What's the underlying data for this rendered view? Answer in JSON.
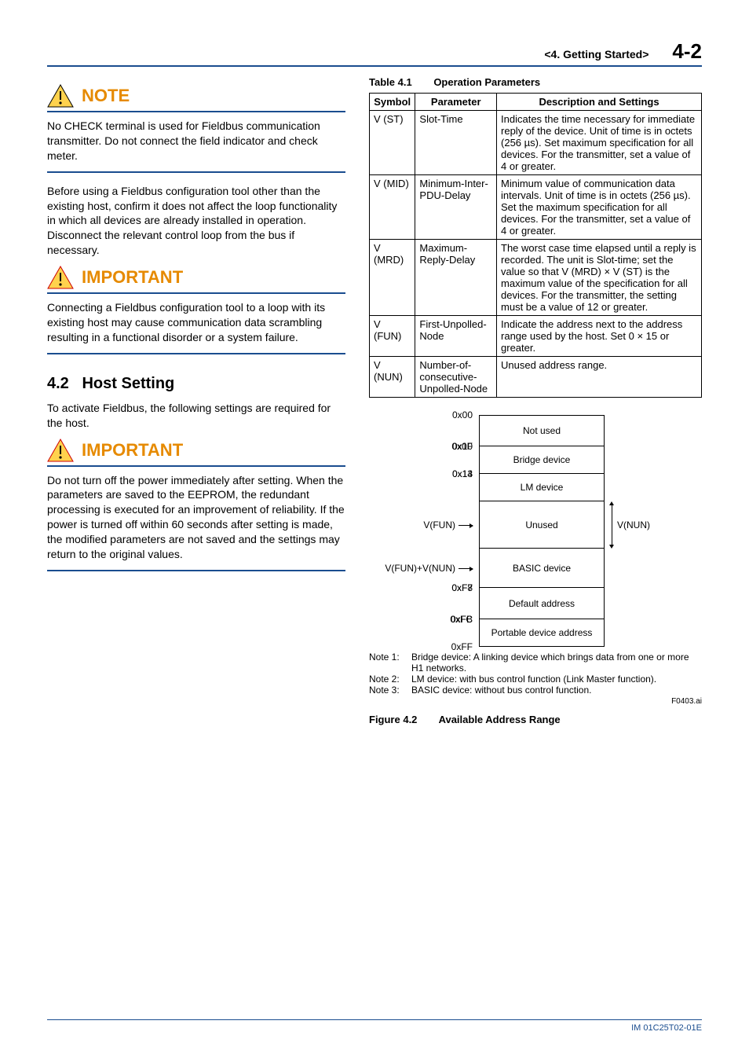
{
  "header": {
    "chapter": "<4.  Getting Started>",
    "page": "4-2"
  },
  "left": {
    "note": {
      "title": "NOTE",
      "body": "No CHECK terminal is used for Fieldbus communication transmitter. Do not connect the field indicator and check meter."
    },
    "para1": "Before using a Fieldbus configuration tool other than the existing host, confirm it does not affect the loop functionality in which all devices are already installed in operation. Disconnect the relevant control loop from the bus if necessary.",
    "important1": {
      "title": "IMPORTANT",
      "body": "Connecting a Fieldbus configuration tool to a loop with its existing host may cause communication data scrambling resulting in a functional disorder or a system failure."
    },
    "section": {
      "number": "4.2",
      "title": "Host Setting"
    },
    "para2": "To activate Fieldbus, the following settings are required for the host.",
    "important2": {
      "title": "IMPORTANT",
      "body": "Do not turn off the power immediately after setting. When the parameters are saved to the EEPROM, the redundant processing is executed for an improvement of reliability. If the power is turned off within 60 seconds after setting is made, the modified parameters are not saved and the settings may return to the original values."
    }
  },
  "right": {
    "table": {
      "number": "Table 4.1",
      "title": "Operation Parameters",
      "headers": [
        "Symbol",
        "Parameter",
        "Description and Settings"
      ],
      "rows": [
        {
          "symbol": "V (ST)",
          "param": "Slot-Time",
          "desc": "Indicates the time necessary for immediate reply of the device. Unit of time is in octets (256 µs). Set maximum specification for all devices. For the transmitter, set a value of 4 or greater."
        },
        {
          "symbol": "V (MID)",
          "param": "Minimum-Inter-PDU-Delay",
          "desc": "Minimum value of communication data intervals. Unit of time is in octets (256 µs). Set the maximum specification for all devices. For the transmitter, set a value of 4 or greater."
        },
        {
          "symbol": "V (MRD)",
          "param": "Maximum-Reply-Delay",
          "desc": "The worst case time elapsed until a reply is recorded. The unit is Slot-time; set the value so that V (MRD) × V (ST) is the maximum value of the specification for all devices. For the transmitter, the setting must be a value of 12 or greater."
        },
        {
          "symbol": "V (FUN)",
          "param": "First-Unpolled-Node",
          "desc": "Indicate the address next to the address range used by the host. Set 0 × 15 or greater."
        },
        {
          "symbol": "V (NUN)",
          "param": "Number-of-consecutive-Unpolled-Node",
          "desc": "Unused address range."
        }
      ]
    },
    "diagram": {
      "ticks": {
        "t0": "0x00",
        "t0f": "0x0F",
        "t10": "0x10",
        "t13": "0x13",
        "t14": "0x14",
        "tf7": "0xF7",
        "tf8": "0xF8",
        "tfb": "0xFB",
        "tfc": "0xFC",
        "tff": "0xFF"
      },
      "left_arrows": {
        "vfun": "V(FUN)",
        "vfun_vnun": "V(FUN)+V(NUN)"
      },
      "boxes": {
        "not_used": "Not used",
        "bridge": "Bridge device",
        "lm": "LM device",
        "unused": "Unused",
        "basic": "BASIC device",
        "default": "Default address",
        "portable": "Portable device address"
      },
      "vnun": "V(NUN)"
    },
    "notes": {
      "n1": {
        "tag": "Note 1:",
        "text": "Bridge device: A linking device which brings data from one or more H1 networks."
      },
      "n2": {
        "tag": "Note 2:",
        "text": "LM device: with bus control function (Link Master function)."
      },
      "n3": {
        "tag": "Note 3:",
        "text": "BASIC device: without bus control function."
      }
    },
    "fig_ref": "F0403.ai",
    "figure": {
      "number": "Figure 4.2",
      "title": "Available Address Range"
    }
  },
  "footer": "IM 01C25T02-01E"
}
